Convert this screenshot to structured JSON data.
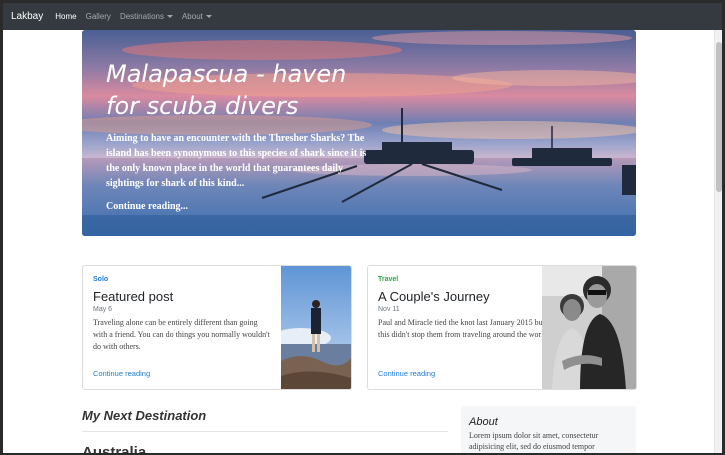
{
  "navbar": {
    "brand": "Lakbay",
    "items": [
      {
        "label": "Home"
      },
      {
        "label": "Gallery"
      },
      {
        "label": "Destinations"
      },
      {
        "label": "About"
      }
    ]
  },
  "hero": {
    "title": "Malapascua - haven for scuba divers",
    "text": "Aiming to have an encounter with the Thresher Sharks? The island has been synonymous to this species of shark since it is the only known place in the world that guarantees daily sightings for shark of this kind...",
    "link": "Continue reading..."
  },
  "cards": [
    {
      "category": "Solo",
      "category_color": "#1f7bd6",
      "title": "Featured post",
      "date": "May 6",
      "excerpt": "Traveling alone can be entirely different than going with a friend. You can do things you normally wouldn't do with others.",
      "link": "Continue reading"
    },
    {
      "category": "Travel",
      "category_color": "#28a745",
      "title": "A Couple's Journey",
      "date": "Nov 11",
      "excerpt": "Paul and Miracle tied the knot last January 2015 but this didn't stop them from traveling around the world.",
      "link": "Continue reading"
    }
  ],
  "section": {
    "title": "My Next Destination",
    "subtitle": "Australia"
  },
  "about": {
    "title": "About",
    "text": "Lorem ipsum dolor sit amet, consectetur adipisicing elit, sed do eiusmod tempor"
  }
}
